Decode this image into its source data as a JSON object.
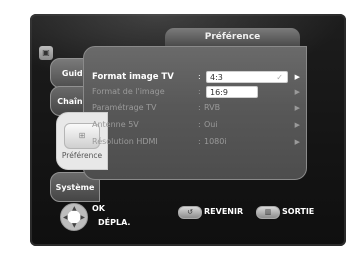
{
  "header": {
    "title": "Préférence"
  },
  "tabs": {
    "guide": "Guide",
    "chaines": "Chaînes",
    "preference": "Préférence",
    "systeme": "Système"
  },
  "rows": [
    {
      "label": "Format image TV",
      "value": "4:3",
      "active": true
    },
    {
      "label": "Format de l'image",
      "value": "16:9",
      "active": false
    },
    {
      "label": "Paramétrage TV",
      "value": "RVB",
      "active": false
    },
    {
      "label": "Antenne 5V",
      "value": "Oui",
      "active": false
    },
    {
      "label": "Résolution HDMI",
      "value": "1080i",
      "active": false
    }
  ],
  "footer": {
    "ok": "OK",
    "depla": "DÉPLA.",
    "revenir": "REVENIR",
    "sortie": "SORTIE"
  },
  "icons": {
    "check": "check-icon",
    "arrow": "right-arrow-icon",
    "dpad": "dpad-icon"
  }
}
